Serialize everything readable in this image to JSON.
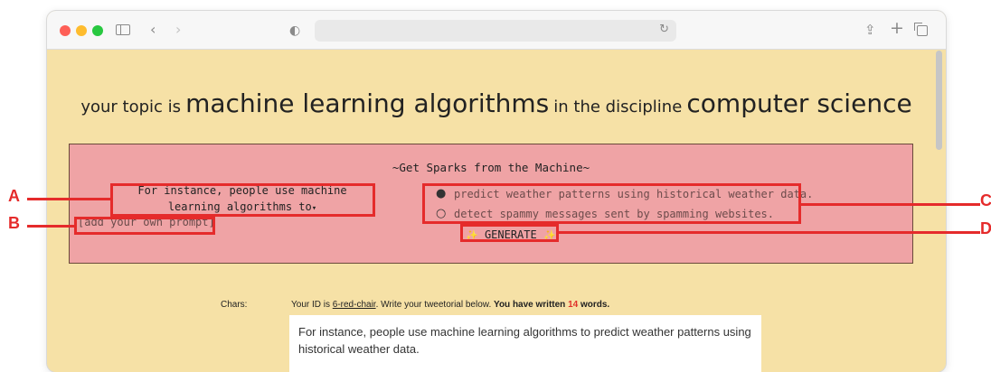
{
  "browser": {
    "icons": {
      "sidebar": "sidebar-icon",
      "back": "chevron-left-icon",
      "forward": "chevron-right-icon",
      "privacy": "shield-icon",
      "reload": "reload-icon",
      "share": "share-icon",
      "new_tab": "plus-icon",
      "tabs": "tabs-icon"
    },
    "address_value": ""
  },
  "topic": {
    "prefix": "your topic is",
    "topic": "machine learning algorithms",
    "middle": "in the discipline",
    "discipline": "computer science"
  },
  "sparks": {
    "title": "~Get Sparks from the Machine~",
    "prompt_sentence": "For instance, people use machine learning algorithms to",
    "dropdown_caret": "▾",
    "own_prompt": "[add your own prompt]",
    "suggestions": [
      {
        "icon": "lightbulb-filled-icon",
        "glyph": "●",
        "text": "predict weather patterns using historical weather data."
      },
      {
        "icon": "lightbulb-outline-icon",
        "glyph": "○",
        "text": "detect spammy messages sent by spamming websites."
      }
    ],
    "generate_label": "GENERATE",
    "sparkle_glyph": "✨"
  },
  "editor": {
    "chars_label": "Chars:",
    "id_prefix": "Your ID is",
    "user_id": "6-red-chair",
    "id_suffix": ". Write your tweetorial below.",
    "written_prefix": "You have written",
    "word_count": "14",
    "written_suffix": "words.",
    "tweet_text": "For instance, people use machine learning algorithms to predict weather patterns using historical weather data."
  },
  "annotations": {
    "labels": [
      "A",
      "B",
      "C",
      "D"
    ],
    "color": "#e52b2b"
  },
  "colors": {
    "page_background": "#f6e1a6",
    "panel_background": "#efa3a5",
    "word_count": "#e0302a"
  }
}
